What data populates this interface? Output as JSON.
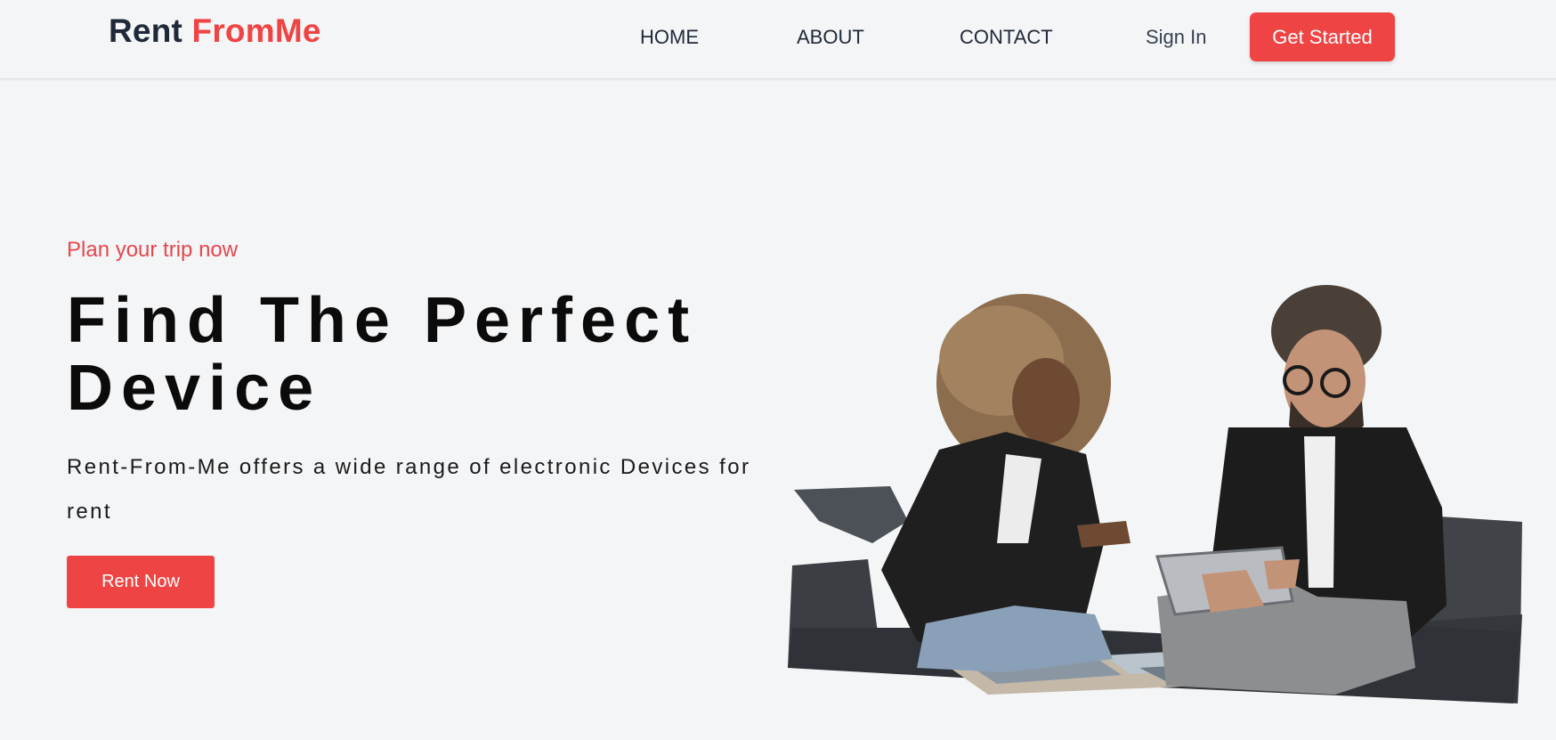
{
  "nav": {
    "brand_part1": "Rent",
    "brand_part2": "FromMe",
    "links": [
      {
        "label": "HOME"
      },
      {
        "label": "ABOUT"
      },
      {
        "label": "CONTACT"
      }
    ],
    "sign_in": "Sign In",
    "get_started": "Get Started"
  },
  "hero": {
    "tagline": "Plan your trip now",
    "headline_line1": "Find The Perfect",
    "headline_line2": "Device",
    "description": "Rent-From-Me offers a wide range of electronic Devices for rent",
    "cta": "Rent Now",
    "image_icon": "people-with-tablet-photo"
  },
  "colors": {
    "accent": "#ef4444",
    "background": "#f4f5f7",
    "brand_dark": "#1e2a3a"
  }
}
